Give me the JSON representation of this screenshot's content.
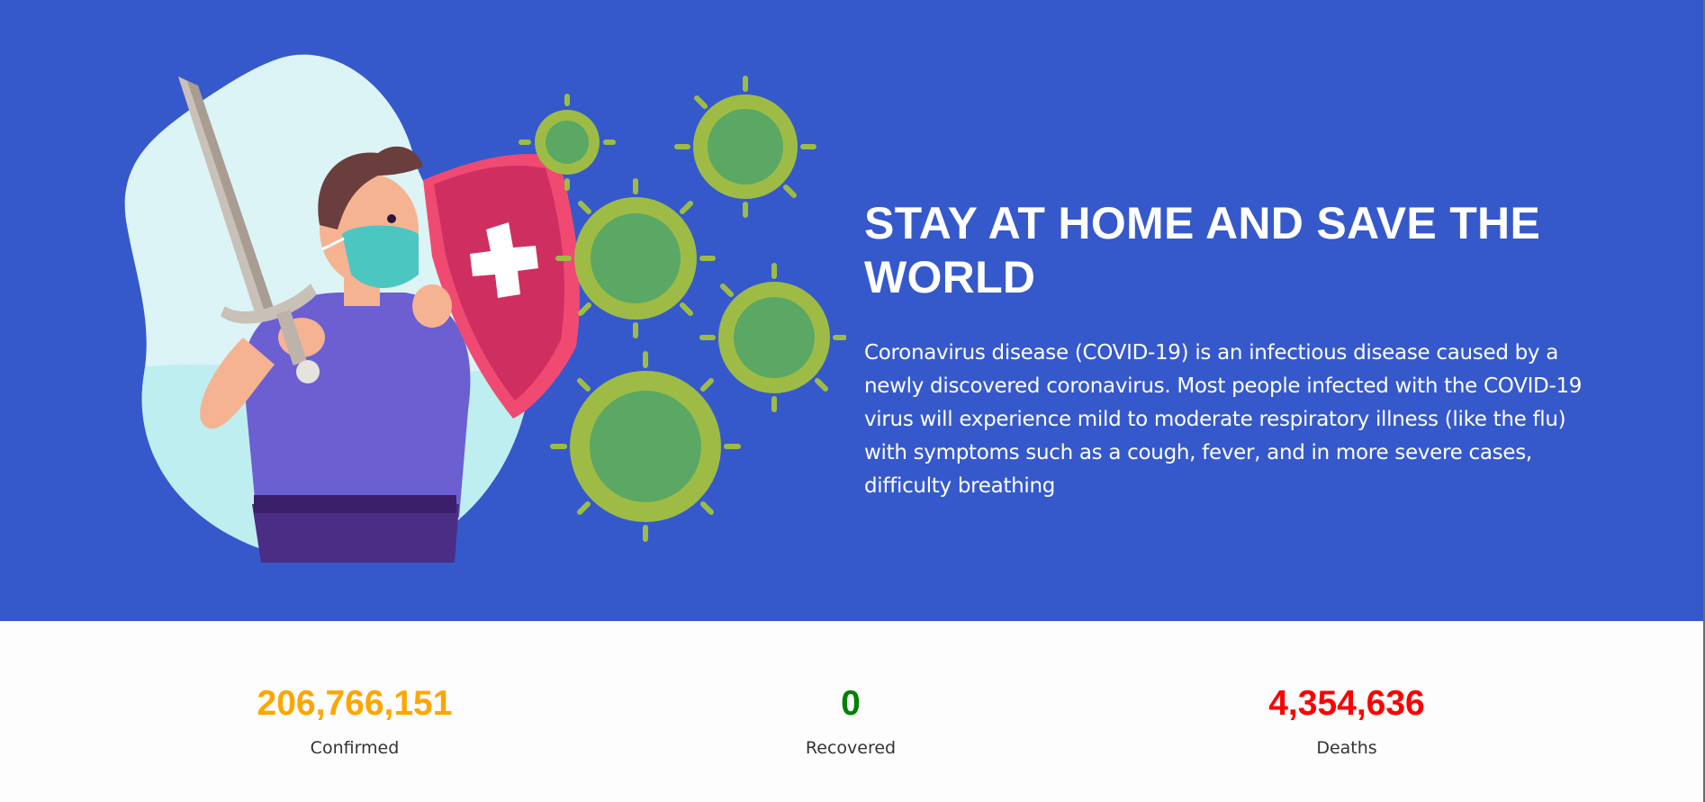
{
  "hero": {
    "title": "STAY AT HOME AND SAVE THE WORLD",
    "description": "Coronavirus disease (COVID-19) is an infectious disease caused by a newly discovered coronavirus. Most people infected with the COVID-19 virus will experience mild to moderate respiratory illness (like the flu) with symptoms such as a cough, fever, and in more severe cases, difficulty breathing",
    "background_color": "#3559cb",
    "illustration_icon": "masked-hero-with-sword-and-shield-fighting-virus"
  },
  "stats": [
    {
      "value": "206,766,151",
      "label": "Confirmed",
      "color": "#ffa500"
    },
    {
      "value": "0",
      "label": "Recovered",
      "color": "#008000"
    },
    {
      "value": "4,354,636",
      "label": "Deaths",
      "color": "#ff0000"
    }
  ]
}
